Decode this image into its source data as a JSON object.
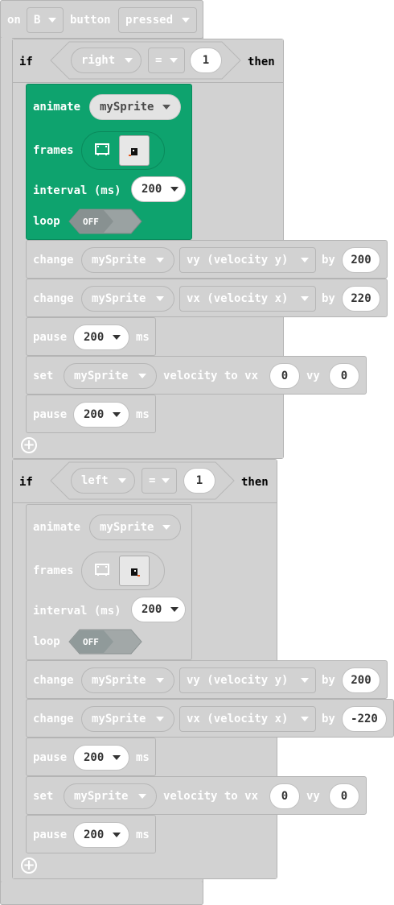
{
  "event": {
    "on_label": "on",
    "button_value": "B",
    "button_label": "button",
    "action_value": "pressed"
  },
  "if_right": {
    "if_label": "if",
    "direction": "right",
    "operator": "=",
    "compare_value": "1",
    "then_label": "then",
    "animate": {
      "animate_label": "animate",
      "sprite": "mySprite",
      "frames_label": "frames",
      "interval_label": "interval (ms)",
      "interval_value": "200",
      "loop_label": "loop",
      "loop_state": "OFF"
    },
    "change_vy": {
      "label": "change",
      "sprite": "mySprite",
      "property": "vy (velocity y)",
      "by_label": "by",
      "value": "200"
    },
    "change_vx": {
      "label": "change",
      "sprite": "mySprite",
      "property": "vx (velocity x)",
      "by_label": "by",
      "value": "220"
    },
    "pause1": {
      "label": "pause",
      "value": "200",
      "unit": "ms"
    },
    "set_velocity": {
      "label": "set",
      "sprite": "mySprite",
      "text": "velocity to vx",
      "vx": "0",
      "vy_label": "vy",
      "vy": "0"
    },
    "pause2": {
      "label": "pause",
      "value": "200",
      "unit": "ms"
    }
  },
  "if_left": {
    "if_label": "if",
    "direction": "left",
    "operator": "=",
    "compare_value": "1",
    "then_label": "then",
    "animate": {
      "animate_label": "animate",
      "sprite": "mySprite",
      "frames_label": "frames",
      "interval_label": "interval (ms)",
      "interval_value": "200",
      "loop_label": "loop",
      "loop_state": "OFF"
    },
    "change_vy": {
      "label": "change",
      "sprite": "mySprite",
      "property": "vy (velocity y)",
      "by_label": "by",
      "value": "200"
    },
    "change_vx": {
      "label": "change",
      "sprite": "mySprite",
      "property": "vx (velocity x)",
      "by_label": "by",
      "value": "-220"
    },
    "pause1": {
      "label": "pause",
      "value": "200",
      "unit": "ms"
    },
    "set_velocity": {
      "label": "set",
      "sprite": "mySprite",
      "text": "velocity to vx",
      "vx": "0",
      "vy_label": "vy",
      "vy": "0"
    },
    "pause2": {
      "label": "pause",
      "value": "200",
      "unit": "ms"
    }
  },
  "colors": {
    "disabled_block": "#d2d2d2",
    "animation_block": "#0ea36e",
    "field_white": "#ffffff"
  },
  "icons": [
    "chevron-down-icon",
    "film-strip-icon",
    "plus-circle-icon",
    "sprite-thumbnail-icon"
  ]
}
